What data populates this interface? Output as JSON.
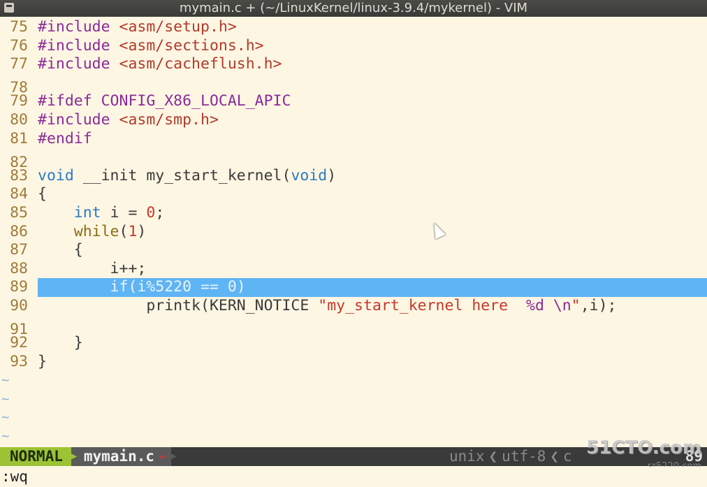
{
  "window": {
    "title": "mymain.c + (~/LinuxKernel/linux-3.9.4/mykernel) - VIM"
  },
  "lines": [
    {
      "num": "75",
      "html": [
        {
          "t": "#include ",
          "c": "pre"
        },
        {
          "t": "<asm/setup.h>",
          "c": "inc"
        }
      ]
    },
    {
      "num": "76",
      "html": [
        {
          "t": "#include ",
          "c": "pre"
        },
        {
          "t": "<asm/sections.h>",
          "c": "inc"
        }
      ]
    },
    {
      "num": "77",
      "html": [
        {
          "t": "#include ",
          "c": "pre"
        },
        {
          "t": "<asm/cacheflush.h>",
          "c": "inc"
        }
      ]
    },
    {
      "num": "78",
      "html": []
    },
    {
      "num": "79",
      "html": [
        {
          "t": "#ifdef CONFIG_X86_LOCAL_APIC",
          "c": "pre"
        }
      ]
    },
    {
      "num": "80",
      "html": [
        {
          "t": "#include ",
          "c": "pre"
        },
        {
          "t": "<asm/smp.h>",
          "c": "inc"
        }
      ]
    },
    {
      "num": "81",
      "html": [
        {
          "t": "#endif",
          "c": "pre"
        }
      ]
    },
    {
      "num": "82",
      "html": []
    },
    {
      "num": "83",
      "html": [
        {
          "t": "void",
          "c": "type"
        },
        {
          "t": " __init my_start_kernel(",
          "c": ""
        },
        {
          "t": "void",
          "c": "type"
        },
        {
          "t": ")",
          "c": ""
        }
      ]
    },
    {
      "num": "84",
      "html": [
        {
          "t": "{",
          "c": ""
        }
      ]
    },
    {
      "num": "85",
      "html": [
        {
          "t": "    ",
          "c": ""
        },
        {
          "t": "int",
          "c": "type"
        },
        {
          "t": " i = ",
          "c": ""
        },
        {
          "t": "0",
          "c": "num"
        },
        {
          "t": ";",
          "c": ""
        }
      ]
    },
    {
      "num": "86",
      "html": [
        {
          "t": "    ",
          "c": ""
        },
        {
          "t": "while",
          "c": "kw"
        },
        {
          "t": "(",
          "c": ""
        },
        {
          "t": "1",
          "c": "num"
        },
        {
          "t": ")",
          "c": ""
        }
      ]
    },
    {
      "num": "87",
      "html": [
        {
          "t": "    {",
          "c": ""
        }
      ]
    },
    {
      "num": "88",
      "html": [
        {
          "t": "        i++;",
          "c": ""
        }
      ]
    },
    {
      "num": "89",
      "html": [
        {
          "t": "        if(i%5220 == 0)",
          "c": ""
        }
      ],
      "cursor": true
    },
    {
      "num": "90",
      "html": [
        {
          "t": "            printk(KERN_NOTICE ",
          "c": ""
        },
        {
          "t": "\"my_start_kernel here  ",
          "c": "str"
        },
        {
          "t": "%d",
          "c": "fmt"
        },
        {
          "t": " ",
          "c": "str"
        },
        {
          "t": "\\n",
          "c": "fmt"
        },
        {
          "t": "\"",
          "c": "str"
        },
        {
          "t": ",i);",
          "c": ""
        }
      ]
    },
    {
      "num": "91",
      "html": []
    },
    {
      "num": "92",
      "html": [
        {
          "t": "    }",
          "c": ""
        }
      ]
    },
    {
      "num": "93",
      "html": [
        {
          "t": "}",
          "c": ""
        }
      ]
    }
  ],
  "tildes": [
    "~",
    "~",
    "~",
    "~"
  ],
  "status": {
    "mode": "NORMAL",
    "filename": "mymain.c",
    "modified": "+",
    "fileformat": "unix",
    "encoding": "utf-8",
    "filetype": "c",
    "percent": "89"
  },
  "watermark": {
    "brand": "51CTO.com",
    "sub": "sr5220.com"
  },
  "cmdline": ":wq"
}
